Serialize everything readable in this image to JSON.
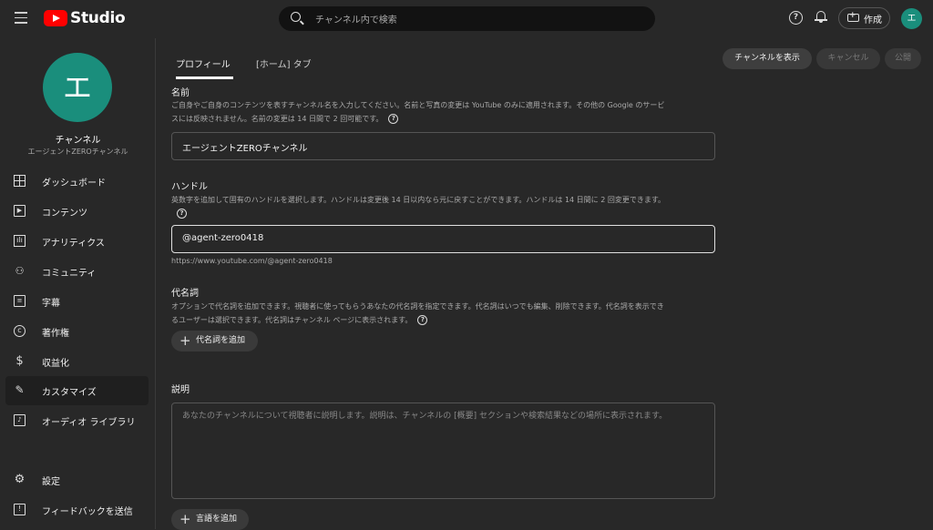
{
  "header": {
    "logo_text": "Studio",
    "search_placeholder": "チャンネル内で検索",
    "help_glyph": "?",
    "create_label": "作成",
    "avatar_letter": "エ"
  },
  "sidebar": {
    "avatar_letter": "エ",
    "channel_label": "チャンネル",
    "channel_name": "エージェントZEROチャンネル",
    "items": [
      {
        "label": "ダッシュボード",
        "icon": "dashboard-icon"
      },
      {
        "label": "コンテンツ",
        "icon": "content-icon"
      },
      {
        "label": "アナリティクス",
        "icon": "analytics-icon"
      },
      {
        "label": "コミュニティ",
        "icon": "community-icon"
      },
      {
        "label": "字幕",
        "icon": "subtitles-icon"
      },
      {
        "label": "著作権",
        "icon": "copyright-icon"
      },
      {
        "label": "収益化",
        "icon": "dollar-icon"
      },
      {
        "label": "カスタマイズ",
        "icon": "magic-wand-icon",
        "active": true
      },
      {
        "label": "オーディオ ライブラリ",
        "icon": "audio-library-icon"
      }
    ],
    "bottom_items": [
      {
        "label": "設定",
        "icon": "gear-icon"
      },
      {
        "label": "フィードバックを送信",
        "icon": "feedback-icon"
      }
    ]
  },
  "tabs": [
    {
      "label": "プロフィール",
      "active": true
    },
    {
      "label": "[ホーム] タブ",
      "active": false
    }
  ],
  "actions": {
    "view_channel": "チャンネルを表示",
    "cancel": "キャンセル",
    "publish": "公開"
  },
  "name_section": {
    "title": "名前",
    "desc_line1": "ご自身やご自身のコンテンツを表すチャンネル名を入力してください。名前と写真の変更は YouTube のみに適用されます。その他の Google のサービ",
    "desc_line2": "スには反映されません。名前の変更は 14 日間で 2 回可能です。",
    "value": "エージェントZEROチャンネル"
  },
  "handle_section": {
    "title": "ハンドル",
    "desc": "英数字を追加して固有のハンドルを選択します。ハンドルは変更後 14 日以内なら元に戻すことができます。ハンドルは 14 日間に 2 回変更できます。",
    "value": "@agent-zero0418",
    "url": "https://www.youtube.com/@agent-zero0418"
  },
  "pronoun_section": {
    "title": "代名詞",
    "desc_line1": "オプションで代名詞を追加できます。視聴者に使ってもらうあなたの代名詞を指定できます。代名詞はいつでも編集、削除できます。代名詞を表示でき",
    "desc_line2": "るユーザーは選択できます。代名詞はチャンネル ページに表示されます。",
    "add_label": "代名詞を追加"
  },
  "description_section": {
    "title": "説明",
    "placeholder": "あなたのチャンネルについて視聴者に説明します。説明は、チャンネルの [概要] セクションや検索結果などの場所に表示されます。",
    "add_language": "言語を追加"
  },
  "colors": {
    "background": "#282828",
    "avatar": "#1a8e7c",
    "brand_red": "#ff0000"
  }
}
